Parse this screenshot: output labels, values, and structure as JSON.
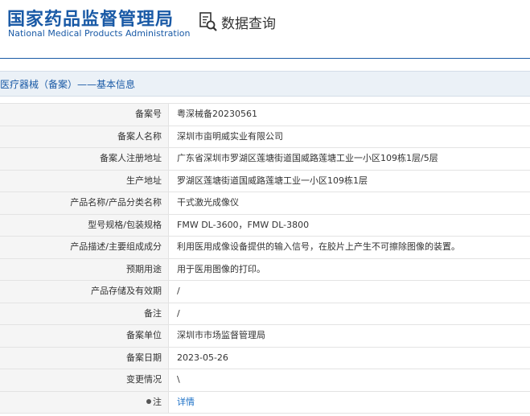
{
  "header": {
    "title_cn": "国家药品监督管理局",
    "title_en": "National Medical Products Administration",
    "query_icon": "document-search-icon",
    "query_label": "数据查询"
  },
  "breadcrumb": "医疗器械（备案）——基本信息",
  "colors": {
    "brand": "#1a5aa6",
    "link": "#1a6fc6",
    "label_bg": "#f5f5f5"
  },
  "rows": [
    {
      "label": "备案号",
      "value": "粤深械备20230561"
    },
    {
      "label": "备案人名称",
      "value": "深圳市亩明威实业有限公司"
    },
    {
      "label": "备案人注册地址",
      "value": "广东省深圳市罗湖区莲塘街道国威路莲塘工业一小区109栋1层/5层"
    },
    {
      "label": "生产地址",
      "value": "罗湖区莲塘街道国威路莲塘工业一小区109栋1层"
    },
    {
      "label": "产品名称/产品分类名称",
      "value": "干式激光成像仪"
    },
    {
      "label": "型号规格/包装规格",
      "value": "FMW DL-3600，FMW DL-3800"
    },
    {
      "label": "产品描述/主要组成成分",
      "value": "利用医用成像设备提供的输入信号，在胶片上产生不可擦除图像的装置。"
    },
    {
      "label": "预期用途",
      "value": "用于医用图像的打印。"
    },
    {
      "label": "产品存储及有效期",
      "value": "/"
    },
    {
      "label": "备注",
      "value": "/"
    },
    {
      "label": "备案单位",
      "value": "深圳市市场监督管理局"
    },
    {
      "label": "备案日期",
      "value": "2023-05-26"
    },
    {
      "label": "变更情况",
      "value": "\\"
    },
    {
      "label": "注",
      "value": "详情"
    }
  ]
}
